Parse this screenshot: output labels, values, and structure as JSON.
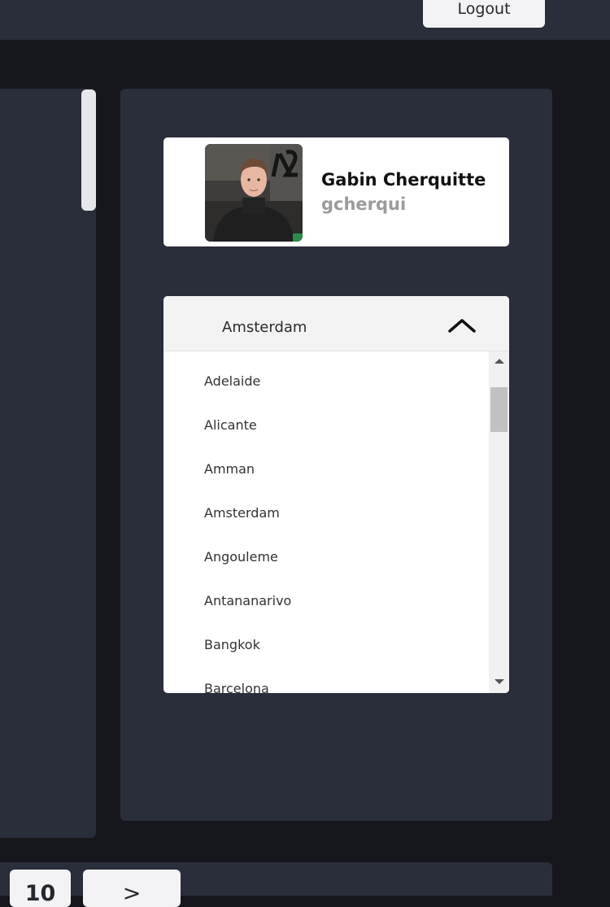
{
  "header": {
    "logout_label": "Logout"
  },
  "profile": {
    "name": "Gabin Cherquitte",
    "login": "gcherqui"
  },
  "campus_select": {
    "selected": "Amsterdam",
    "options": [
      "Adelaide",
      "Alicante",
      "Amman",
      "Amsterdam",
      "Angouleme",
      "Antananarivo",
      "Bangkok",
      "Barcelona"
    ]
  },
  "pagination": {
    "page_size": "10",
    "next_label": ">"
  },
  "icons": {
    "dropdown_toggle": "chevron-up-icon",
    "scroll_up": "scroll-up-arrow-icon",
    "scroll_down": "scroll-down-arrow-icon"
  },
  "colors": {
    "page_background": "#16171c",
    "panel_background": "#2a2d3a",
    "card_background": "#ffffff",
    "button_background": "#f3f3f5",
    "login_text": "#9b9b9b"
  }
}
